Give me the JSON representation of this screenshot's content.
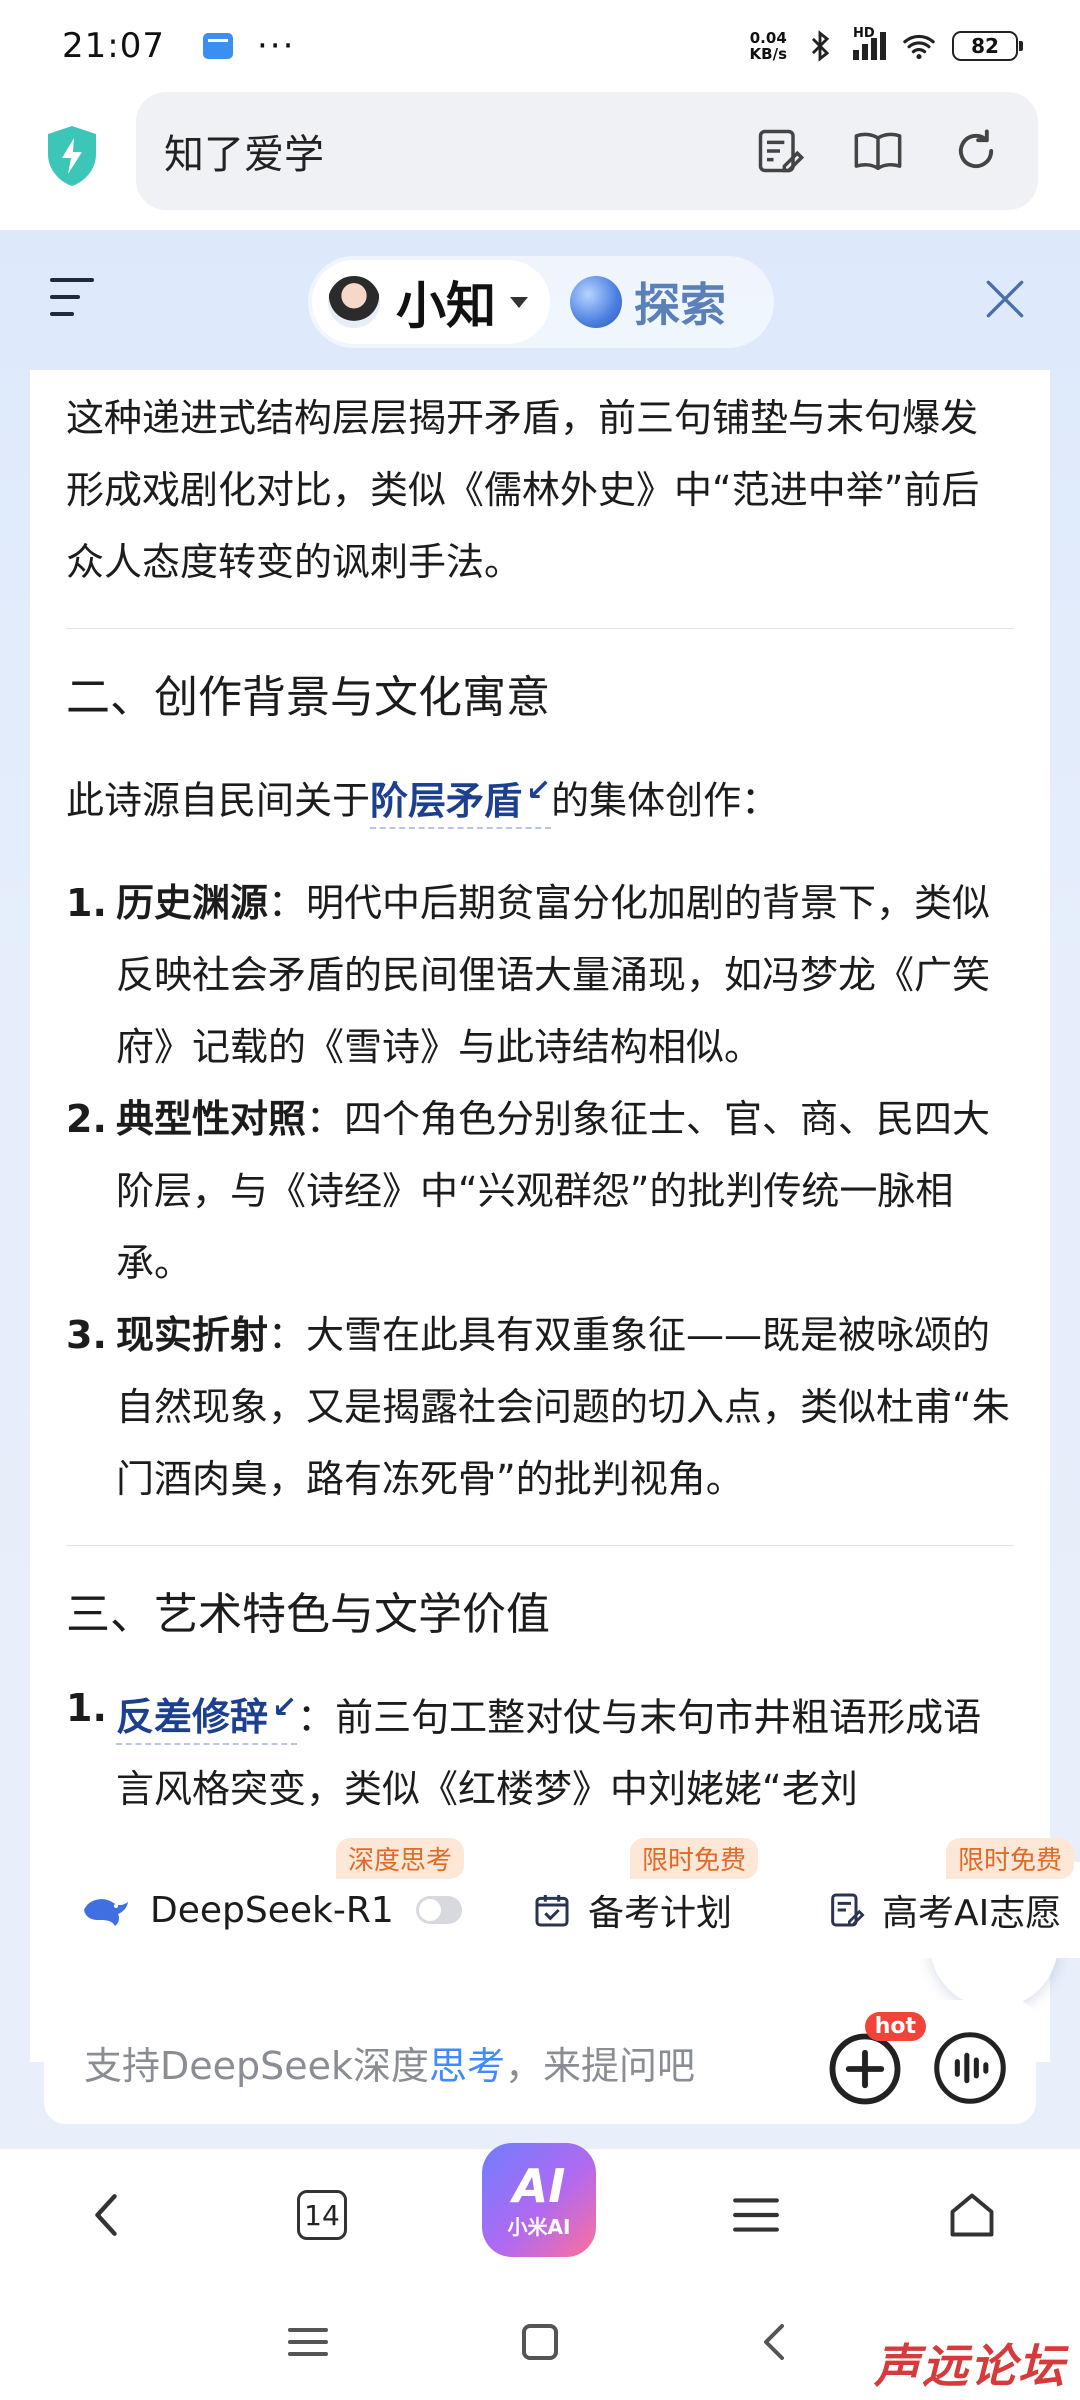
{
  "status_bar": {
    "time": "21:07",
    "speed_top": "0.04",
    "speed_bottom": "KB/s",
    "signal_label": "HD",
    "battery": "82"
  },
  "address_bar": {
    "site_title": "知了爱学"
  },
  "panel": {
    "assistant_name": "小知",
    "explore_label": "探索"
  },
  "content": {
    "paragraph_1": "这种递进式结构层层揭开矛盾，前三句铺垫与末句爆发形成戏剧化对比，类似《儒林外史》中“范进中举”前后众人态度转变的讽刺手法。",
    "section_2_title": "二、创作背景与文化寓意",
    "section_2_intro_pre": "此诗源自民间关于",
    "section_2_intro_link": "阶层矛盾",
    "section_2_intro_post": "的集体创作：",
    "section_2_items": [
      {
        "num": "1.",
        "title": "历史渊源",
        "text": "：明代中后期贫富分化加剧的背景下，类似反映社会矛盾的民间俚语大量涌现，如冯梦龙《广笑府》记载的《雪诗》与此诗结构相似。"
      },
      {
        "num": "2.",
        "title": "典型性对照",
        "text": "：四个角色分别象征士、官、商、民四大阶层，与《诗经》中“兴观群怨”的批判传统一脉相承。"
      },
      {
        "num": "3.",
        "title": "现实折射",
        "text": "：大雪在此具有双重象征——既是被咏颂的自然现象，又是揭露社会问题的切入点，类似杜甫“朱门酒肉臭，路有冻死骨”的批判视角。"
      }
    ],
    "section_3_title": "三、艺术特色与文学价值",
    "section_3_item_num": "1.",
    "section_3_item_link": "反差修辞",
    "section_3_item_text": "：前三句工整对仗与末句市井粗语形成语言风格突变，类似《红楼梦》中刘姥姥“老刘"
  },
  "chips": [
    {
      "label": "DeepSeek-R1",
      "tag": "深度思考"
    },
    {
      "label": "备考计划",
      "tag": "限时免费"
    },
    {
      "label": "高考AI志愿",
      "tag": "限时免费"
    }
  ],
  "input": {
    "placeholder_pre": "支持DeepSeek深度",
    "placeholder_hl": "思考",
    "placeholder_post": "，来提问吧",
    "hot_badge": "hot"
  },
  "bottom_nav": {
    "tab_count": "14",
    "ai_logo": "AI",
    "ai_label": "小米AI"
  },
  "watermark": "声远论坛",
  "colors": {
    "accent_link": "#1d3f8f",
    "tag_orange": "#e06a2a",
    "hot_red": "#f2433b",
    "highlight_blue": "#3f8bff"
  }
}
